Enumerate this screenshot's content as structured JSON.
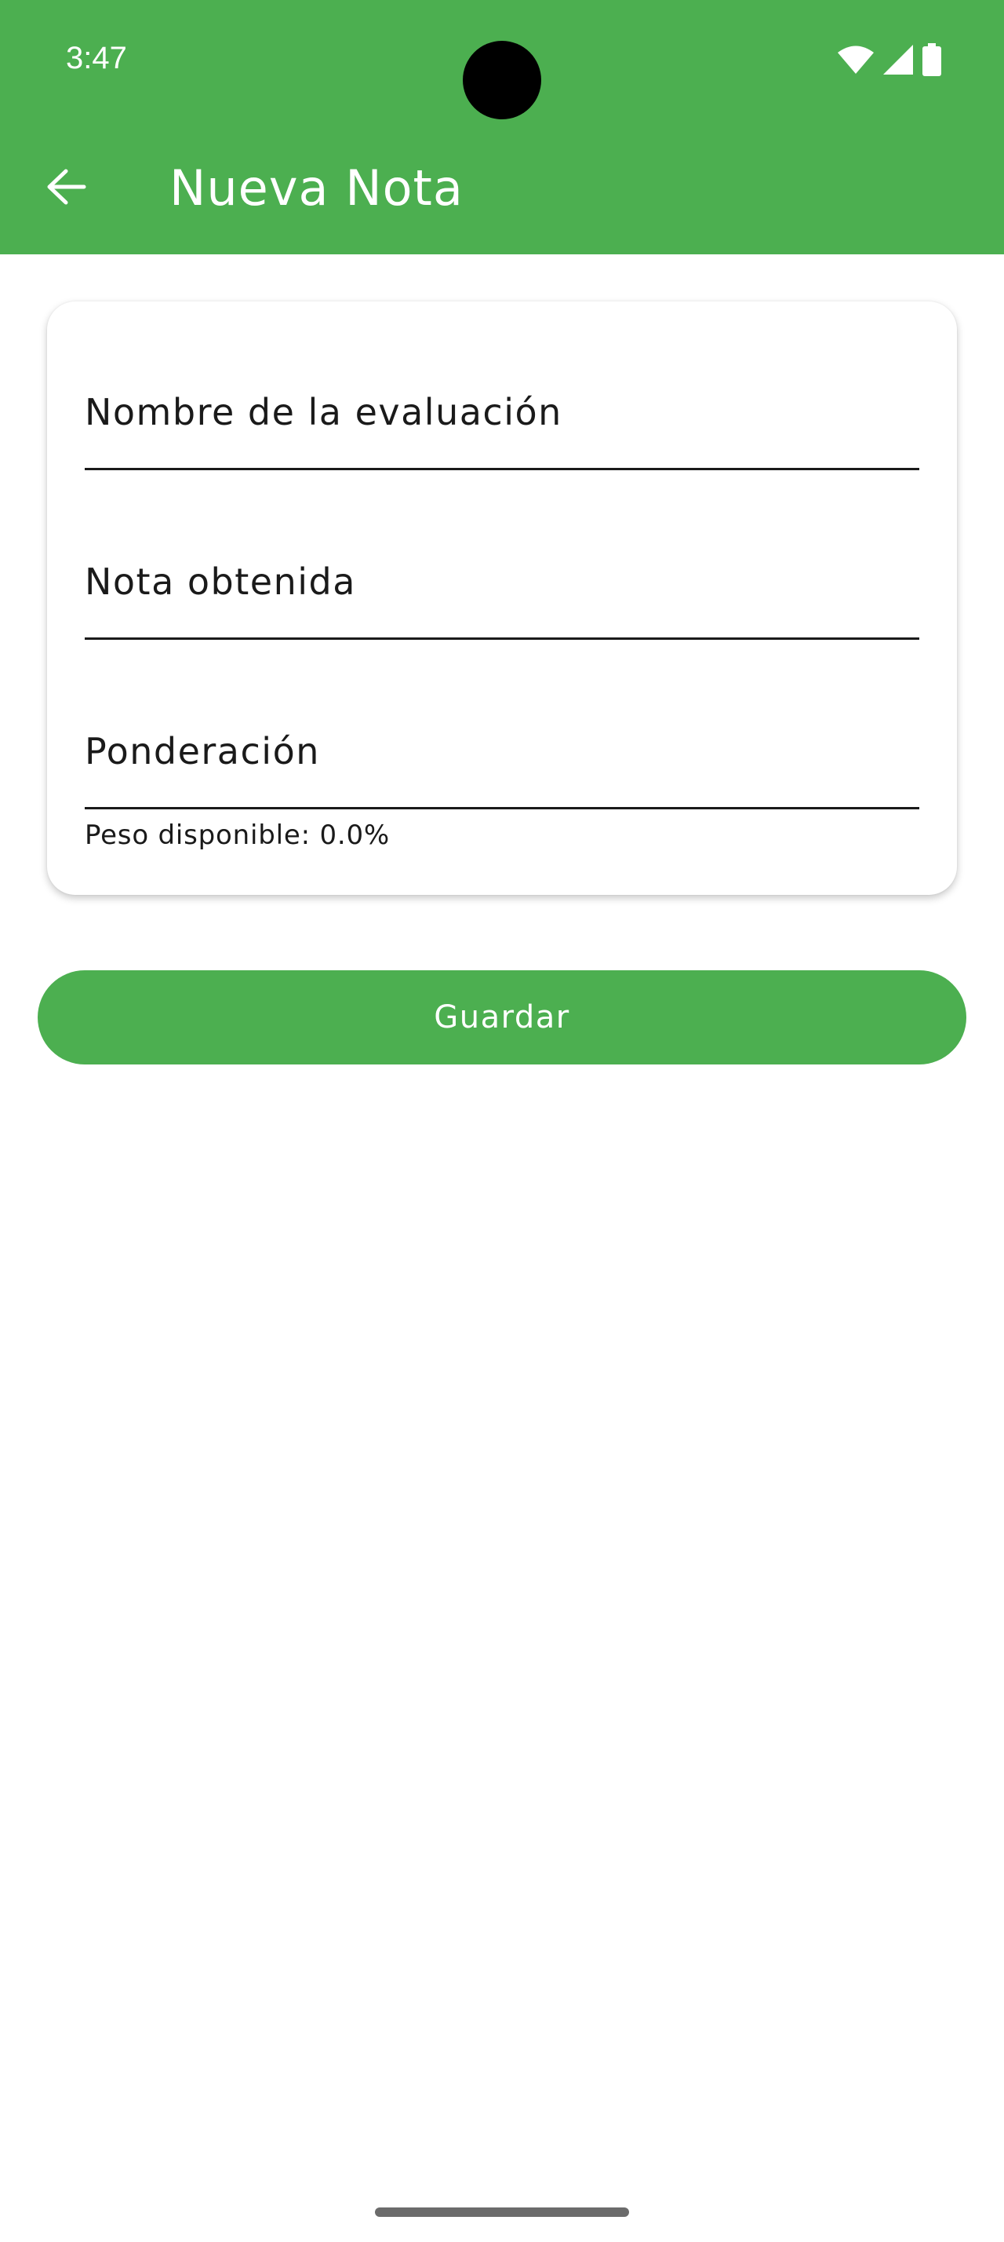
{
  "status_bar": {
    "time": "3:47",
    "icons": [
      "wifi-icon",
      "signal-icon",
      "battery-icon"
    ]
  },
  "app_bar": {
    "back_icon": "arrow-left-icon",
    "title": "Nueva Nota",
    "color": "#4caf50"
  },
  "form": {
    "fields": [
      {
        "label": "Nombre de la evaluación",
        "value": ""
      },
      {
        "label": "Nota obtenida",
        "value": ""
      },
      {
        "label": "Ponderación",
        "value": ""
      }
    ],
    "helper_text": "Peso disponible: 0.0%"
  },
  "actions": {
    "save_label": "Guardar"
  }
}
